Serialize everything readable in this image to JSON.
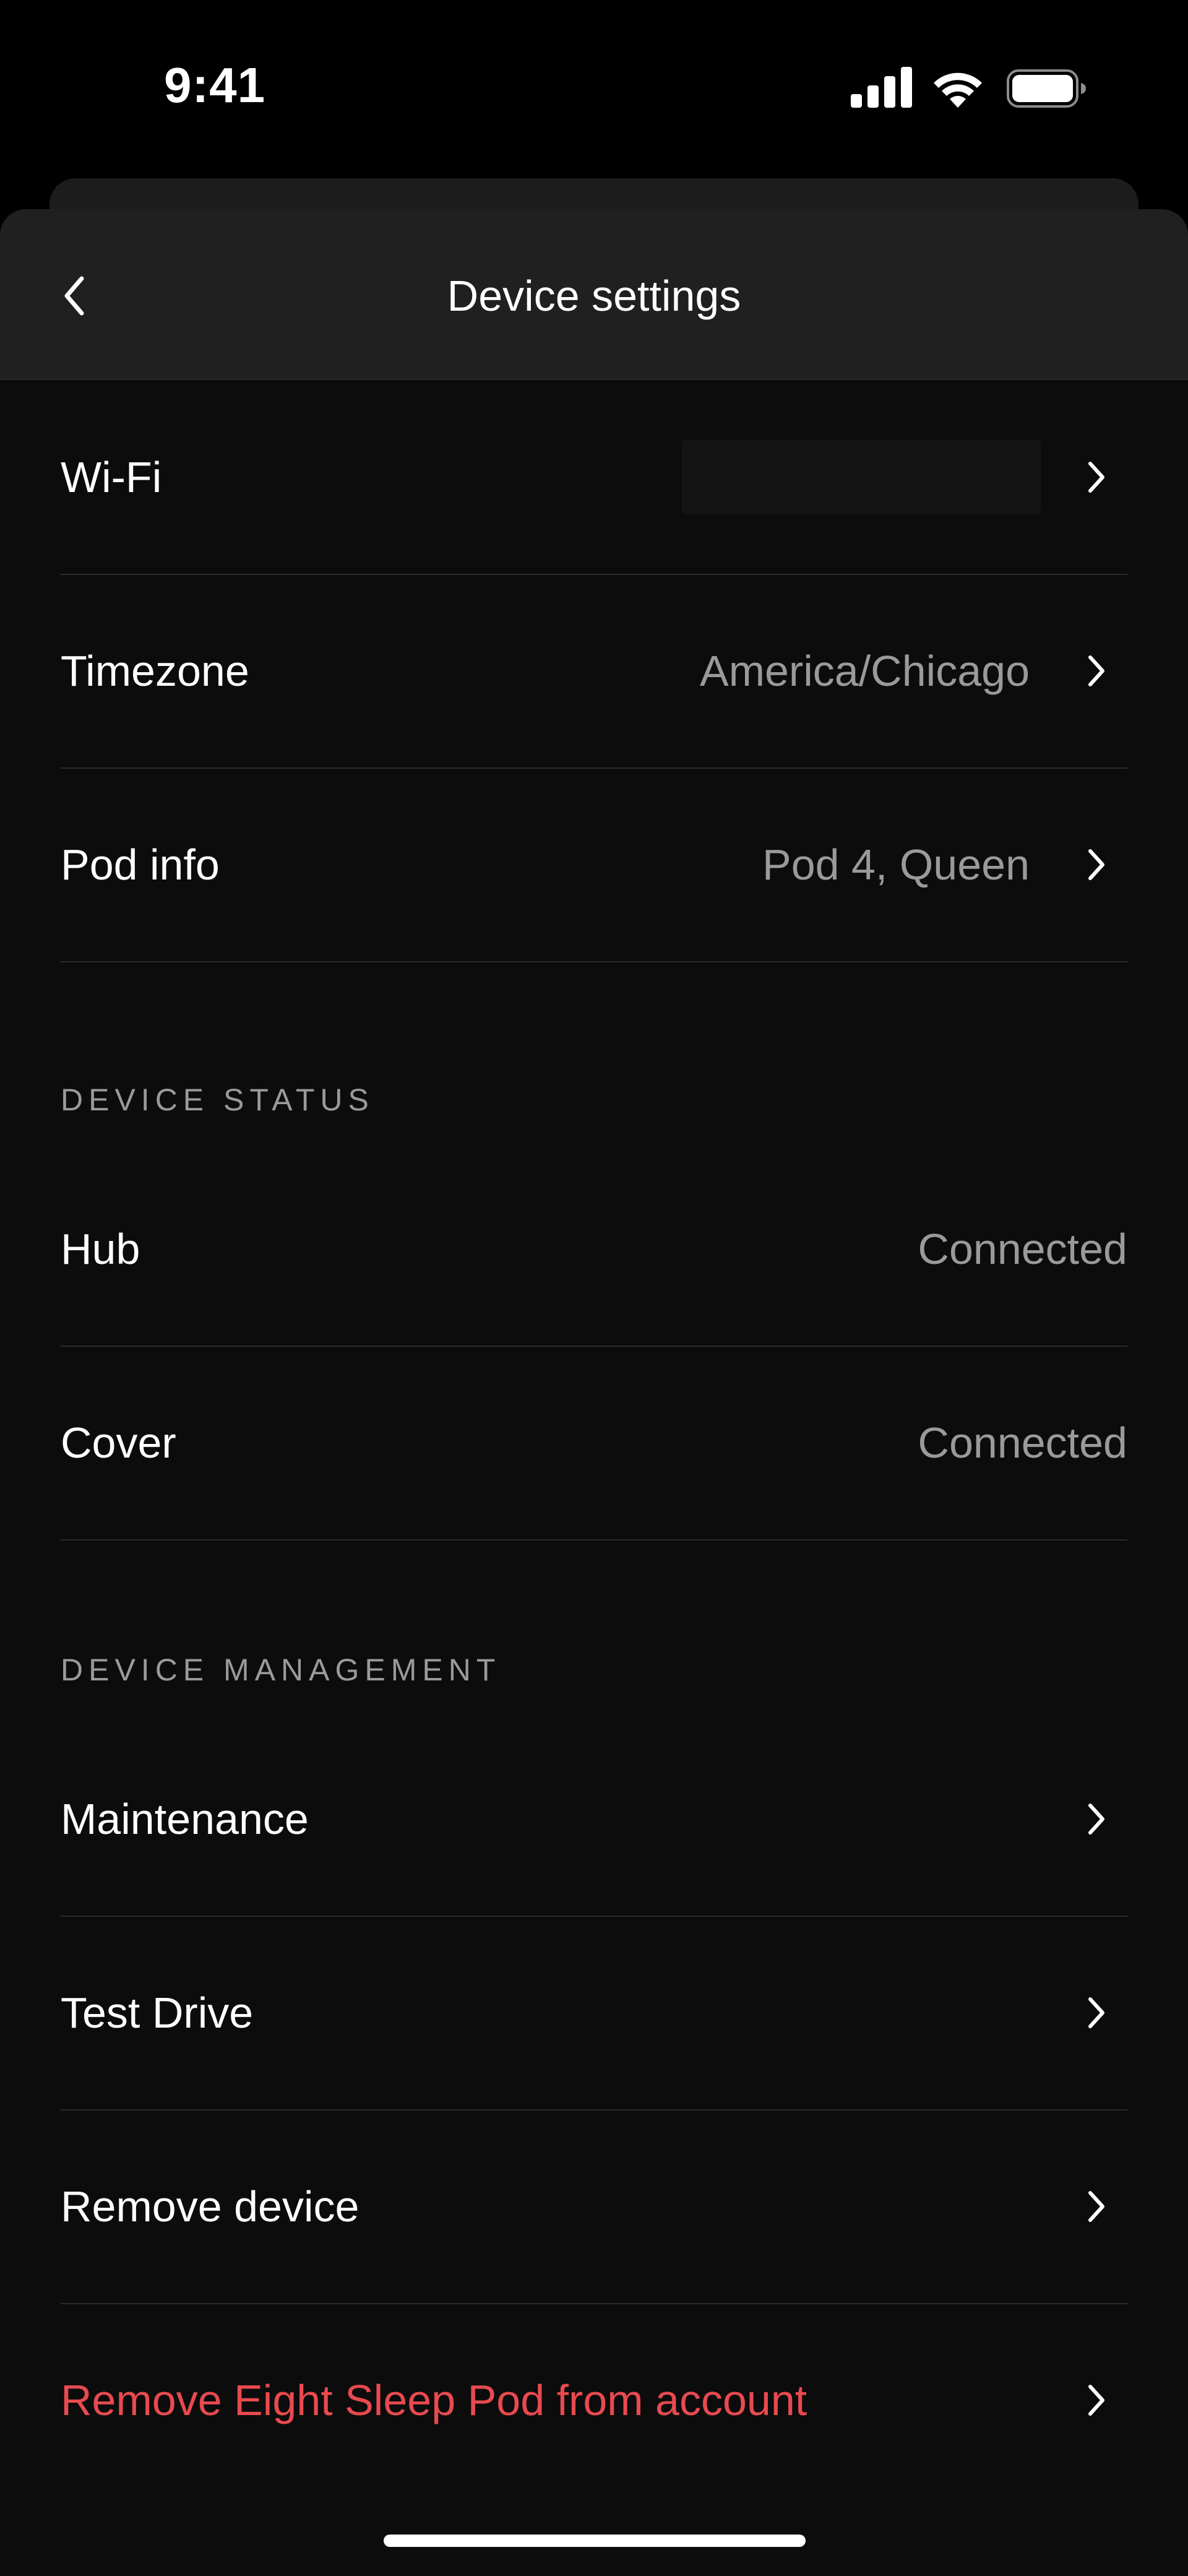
{
  "status_bar": {
    "time": "9:41"
  },
  "header": {
    "title": "Device settings"
  },
  "settings": {
    "wifi": {
      "label": "Wi-Fi",
      "value": ""
    },
    "timezone": {
      "label": "Timezone",
      "value": "America/Chicago"
    },
    "pod_info": {
      "label": "Pod info",
      "value": "Pod 4, Queen"
    }
  },
  "device_status": {
    "header": "DEVICE STATUS",
    "hub": {
      "label": "Hub",
      "value": "Connected"
    },
    "cover": {
      "label": "Cover",
      "value": "Connected"
    }
  },
  "device_management": {
    "header": "DEVICE MANAGEMENT",
    "maintenance": {
      "label": "Maintenance"
    },
    "test_drive": {
      "label": "Test Drive"
    },
    "remove_device": {
      "label": "Remove device"
    },
    "remove_pod": {
      "label": "Remove Eight Sleep Pod from account"
    }
  },
  "colors": {
    "background": "#0c0c0c",
    "header_background": "#202020",
    "primary_text": "#ffffff",
    "secondary_text": "#9a9a9a",
    "danger_text": "#e84a4f",
    "divider": "#2c2c2c"
  },
  "icons": {
    "back": "chevron-left-icon",
    "row_chevron": "chevron-right-icon",
    "signal": "cellular-signal-icon",
    "wifi": "wifi-icon",
    "battery": "battery-icon"
  }
}
